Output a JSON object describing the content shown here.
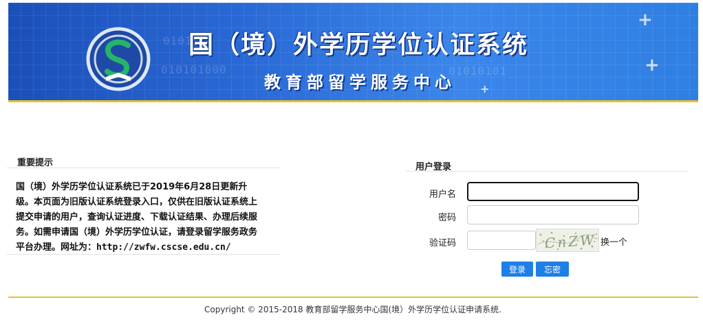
{
  "banner": {
    "title": "国（境）外学历学位认证系统",
    "subtitle": "教育部留学服务中心",
    "colors": {
      "primary": "#1b4fb8",
      "accent_line": "#e8c12a"
    }
  },
  "notice": {
    "heading": "重要提示",
    "text": "国（境）外学历学位认证系统已于2019年6月28日更新升级。本页面为旧版认证系统登录入口，仅供在旧版认证系统上提交申请的用户，查询认证进度、下载认证结果、办理后续服务。如需申请国（境）外学历学位认证，请登录留学服务政务平台办理。网址为：",
    "url": "http://zwfw.cscse.edu.cn/"
  },
  "login": {
    "heading": "用户登录",
    "username_label": "用户名",
    "username_value": "",
    "password_label": "密码",
    "password_value": "",
    "captcha_label": "验证码",
    "captcha_value": "",
    "captcha_text": "CnZW",
    "refresh_label": "换一个",
    "login_button": "登录",
    "forgot_button": "忘密",
    "button_color": "#1e7fe6"
  },
  "footer": {
    "copyright": "Copyright © 2015-2018 教育部留学服务中心国(境）外学历学位认证申请系统."
  }
}
